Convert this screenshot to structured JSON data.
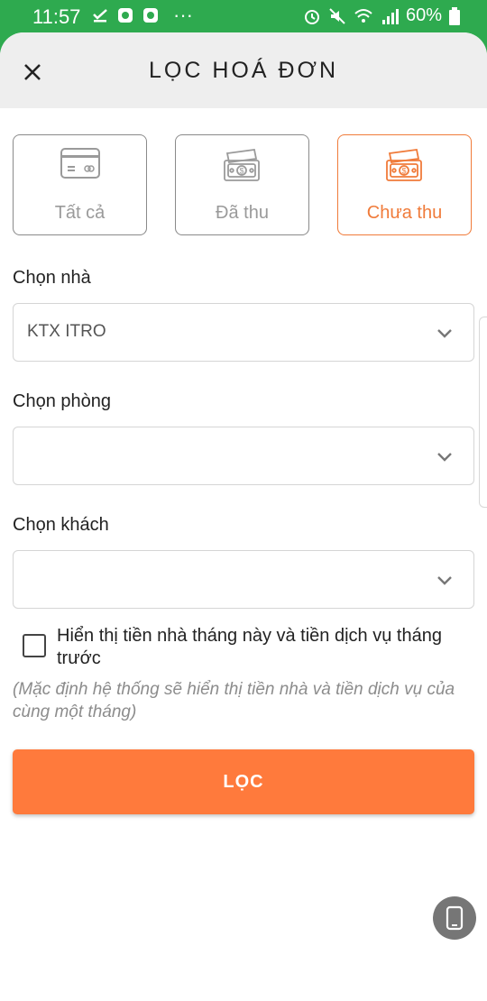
{
  "status_bar": {
    "time": "11:57",
    "dots": "···",
    "battery": "60%",
    "color": "#2EAA4F"
  },
  "header": {
    "title": "LỌC HOÁ ĐƠN",
    "close_icon": "close-icon"
  },
  "tabs": [
    {
      "label": "Tất cả",
      "icon": "card-icon",
      "active": false
    },
    {
      "label": "Đã thu",
      "icon": "cash-icon",
      "active": false
    },
    {
      "label": "Chưa thu",
      "icon": "cash-icon",
      "active": true
    }
  ],
  "fields": {
    "house": {
      "label": "Chọn nhà",
      "value": "KTX ITRO"
    },
    "room": {
      "label": "Chọn phòng",
      "value": ""
    },
    "guest": {
      "label": "Chọn khách",
      "value": ""
    }
  },
  "option": {
    "checkbox_label": "Hiển thị tiền nhà tháng này và tiền dịch vụ tháng trước",
    "checked": false,
    "hint": "(Mặc định hệ thống sẽ hiển thị tiền nhà và tiền dịch vụ của cùng một tháng)"
  },
  "actions": {
    "filter_label": "LỌC"
  },
  "colors": {
    "accent": "#FF7A3C",
    "active_tab": "#F07B3A",
    "inactive": "#8A8A8A"
  }
}
